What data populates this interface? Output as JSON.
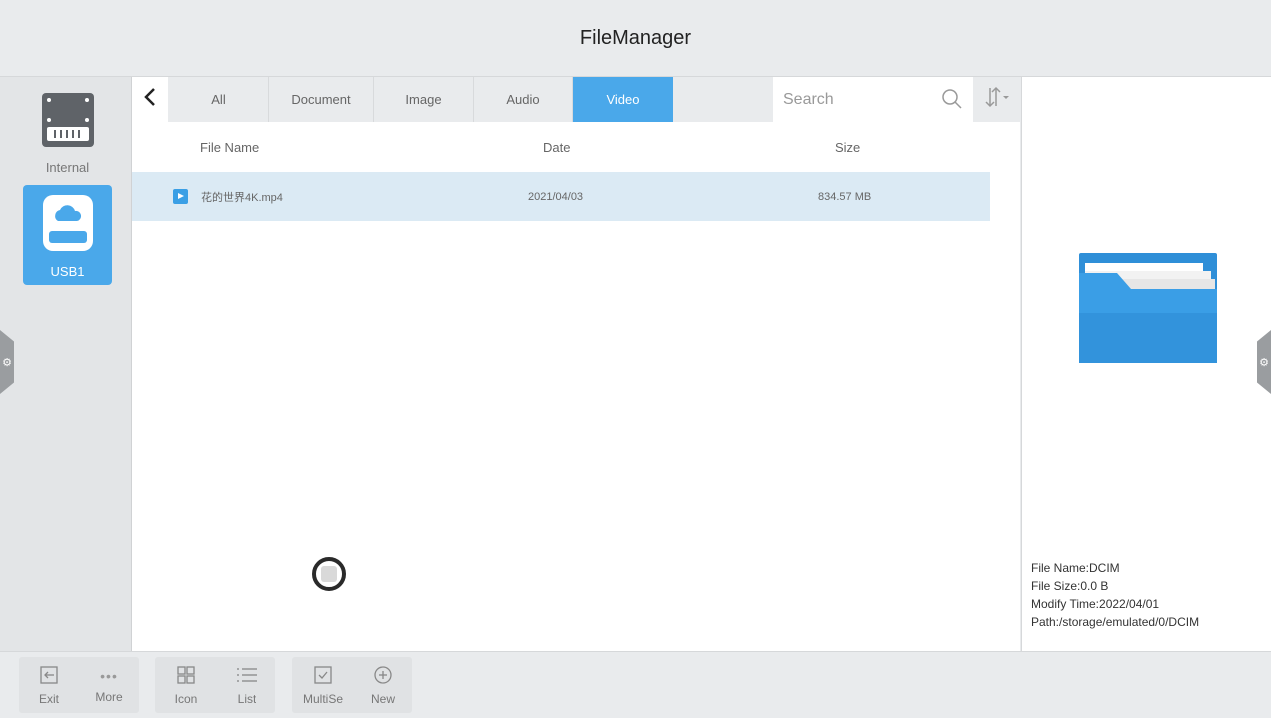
{
  "app": {
    "title": "FileManager"
  },
  "sidebar": {
    "devices": [
      {
        "label": "Internal",
        "icon": "hard-drive-icon"
      },
      {
        "label": "USB1",
        "icon": "usb-drive-icon",
        "selected": true
      }
    ]
  },
  "tabs": [
    {
      "label": "All"
    },
    {
      "label": "Document"
    },
    {
      "label": "Image"
    },
    {
      "label": "Audio"
    },
    {
      "label": "Video",
      "active": true
    }
  ],
  "search": {
    "placeholder": "Search",
    "value": ""
  },
  "table": {
    "headers": {
      "name": "File Name",
      "date": "Date",
      "size": "Size"
    },
    "rows": [
      {
        "name": "花的世界4K.mp4",
        "date": "2021/04/03",
        "size": "834.57 MB",
        "icon": "video-file-icon",
        "selected": true
      }
    ]
  },
  "details": {
    "file_name": "File Name:DCIM",
    "file_size": "File Size:0.0 B",
    "modify_time": "Modify Time:2022/04/01",
    "path": "Path:/storage/emulated/0/DCIM"
  },
  "bottombar": {
    "exit": "Exit",
    "more": "More",
    "icon_view": "Icon",
    "list_view": "List",
    "multiselect": "MultiSe",
    "new": "New"
  },
  "colors": {
    "accent": "#4aa8ea",
    "selected_row": "#dbeaf4",
    "folder": "#2f8fd8"
  }
}
